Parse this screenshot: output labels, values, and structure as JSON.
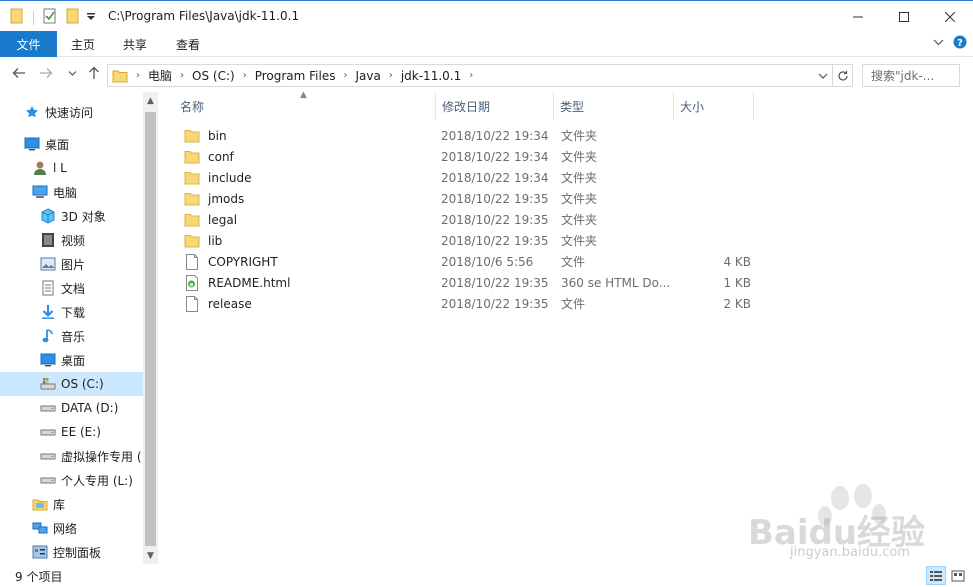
{
  "window": {
    "title": "C:\\Program Files\\Java\\jdk-11.0.1"
  },
  "ribbon": {
    "file": "文件",
    "tabs": [
      "主页",
      "共享",
      "查看"
    ]
  },
  "address": {
    "crumbs": [
      "电脑",
      "OS (C:)",
      "Program Files",
      "Java",
      "jdk-11.0.1"
    ],
    "search_placeholder": "搜索\"jdk-..."
  },
  "sidebar": {
    "items": [
      {
        "label": "快速访问",
        "icon": "star-icon",
        "indent": 1
      },
      {
        "label": "桌面",
        "icon": "desktop-icon",
        "indent": 1
      },
      {
        "label": "l L",
        "icon": "user-icon",
        "indent": 2
      },
      {
        "label": "电脑",
        "icon": "computer-icon",
        "indent": 2
      },
      {
        "label": "3D 对象",
        "icon": "cube-icon",
        "indent": 3
      },
      {
        "label": "视频",
        "icon": "video-icon",
        "indent": 3
      },
      {
        "label": "图片",
        "icon": "picture-icon",
        "indent": 3
      },
      {
        "label": "文档",
        "icon": "document-icon",
        "indent": 3
      },
      {
        "label": "下载",
        "icon": "download-icon",
        "indent": 3
      },
      {
        "label": "音乐",
        "icon": "music-icon",
        "indent": 3
      },
      {
        "label": "桌面",
        "icon": "desktop-icon",
        "indent": 3
      },
      {
        "label": "OS (C:)",
        "icon": "os-drive-icon",
        "indent": 3,
        "selected": true
      },
      {
        "label": "DATA (D:)",
        "icon": "drive-icon",
        "indent": 3
      },
      {
        "label": "EE (E:)",
        "icon": "drive-icon",
        "indent": 3
      },
      {
        "label": "虚拟操作专用 (",
        "icon": "drive-icon",
        "indent": 3
      },
      {
        "label": "个人专用 (L:)",
        "icon": "drive-icon",
        "indent": 3
      },
      {
        "label": "库",
        "icon": "library-icon",
        "indent": 2
      },
      {
        "label": "网络",
        "icon": "network-icon",
        "indent": 2
      },
      {
        "label": "控制面板",
        "icon": "control-panel-icon",
        "indent": 2
      }
    ]
  },
  "columns": {
    "name": "名称",
    "date": "修改日期",
    "type": "类型",
    "size": "大小"
  },
  "files": [
    {
      "name": "bin",
      "date": "2018/10/22 19:34",
      "type": "文件夹",
      "size": "",
      "icon": "folder-icon"
    },
    {
      "name": "conf",
      "date": "2018/10/22 19:34",
      "type": "文件夹",
      "size": "",
      "icon": "folder-icon"
    },
    {
      "name": "include",
      "date": "2018/10/22 19:34",
      "type": "文件夹",
      "size": "",
      "icon": "folder-icon"
    },
    {
      "name": "jmods",
      "date": "2018/10/22 19:35",
      "type": "文件夹",
      "size": "",
      "icon": "folder-icon"
    },
    {
      "name": "legal",
      "date": "2018/10/22 19:35",
      "type": "文件夹",
      "size": "",
      "icon": "folder-icon"
    },
    {
      "name": "lib",
      "date": "2018/10/22 19:35",
      "type": "文件夹",
      "size": "",
      "icon": "folder-icon"
    },
    {
      "name": "COPYRIGHT",
      "date": "2018/10/6 5:56",
      "type": "文件",
      "size": "4 KB",
      "icon": "file-icon"
    },
    {
      "name": "README.html",
      "date": "2018/10/22 19:35",
      "type": "360 se HTML Do...",
      "size": "1 KB",
      "icon": "html-file-icon"
    },
    {
      "name": "release",
      "date": "2018/10/22 19:35",
      "type": "文件",
      "size": "2 KB",
      "icon": "file-icon"
    }
  ],
  "status": {
    "count": "9 个项目"
  },
  "watermark": {
    "text": "Baidu经验",
    "sub": "jingyan.baidu.com"
  }
}
